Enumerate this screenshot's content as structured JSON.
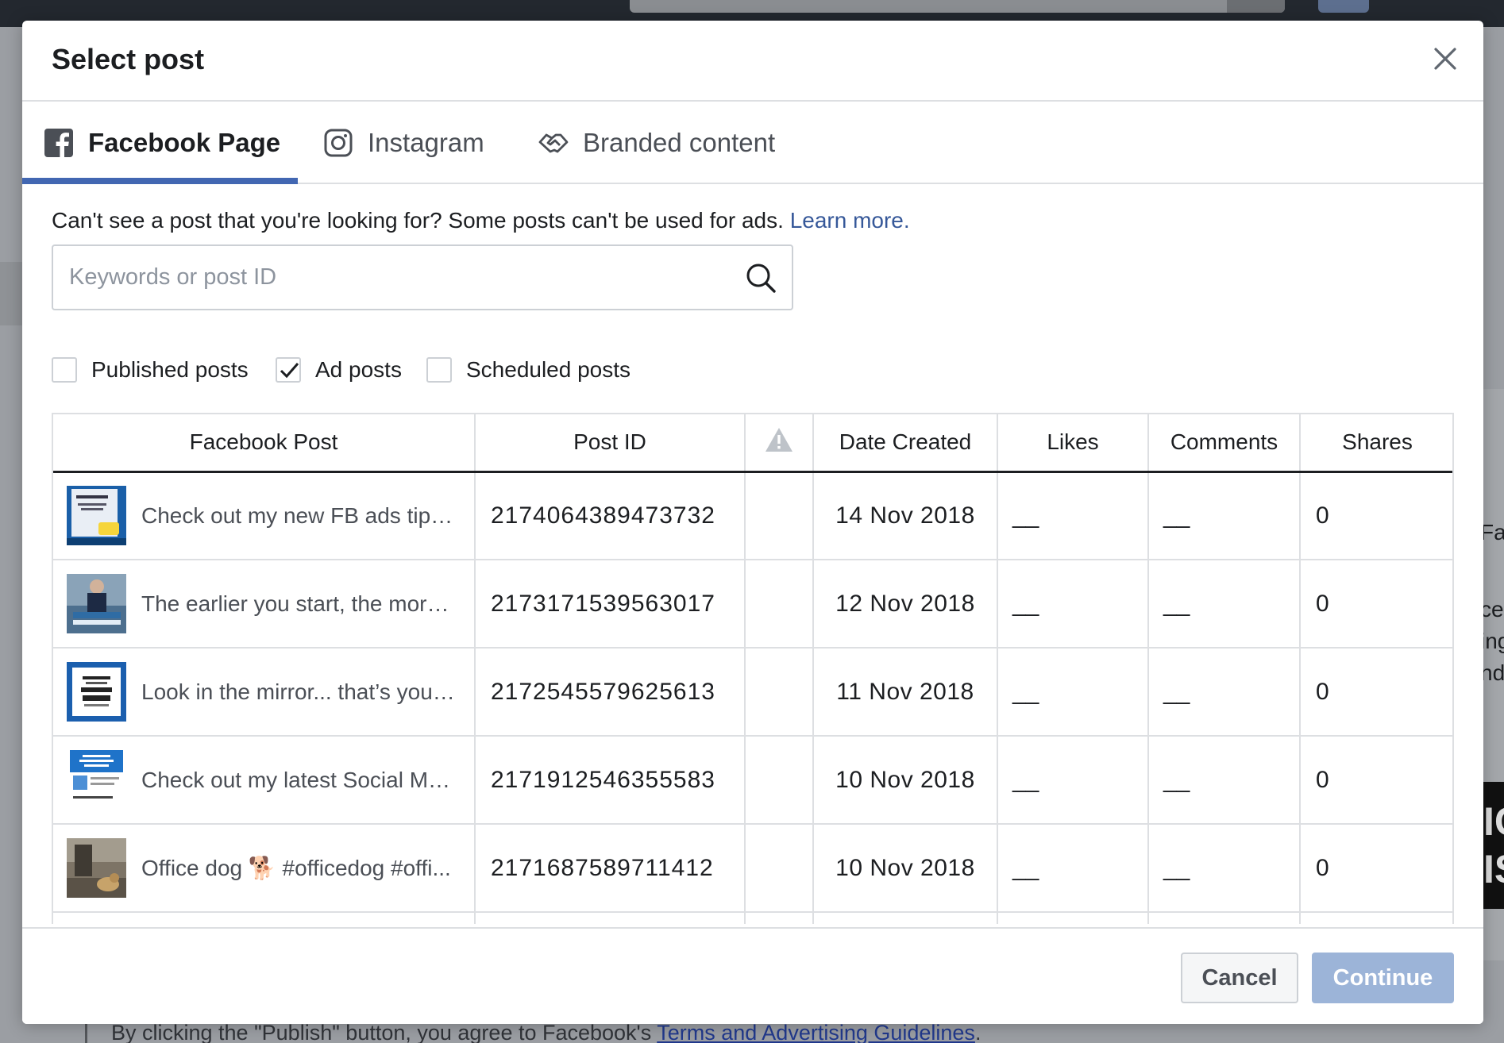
{
  "background": {
    "footer_text": "By clicking the \"Publish\" button, you agree to Facebook's ",
    "footer_link": "Terms and Advertising Guidelines",
    "footer_end": ".",
    "right_fragments": [
      "Fac",
      "ce",
      "ing",
      "nd"
    ],
    "right_black_lines": [
      "IC",
      "IS"
    ]
  },
  "modal": {
    "title": "Select post",
    "close_icon": "close-icon"
  },
  "tabs": [
    {
      "label": "Facebook Page",
      "icon": "facebook-icon",
      "active": true
    },
    {
      "label": "Instagram",
      "icon": "instagram-icon",
      "active": false
    },
    {
      "label": "Branded content",
      "icon": "handshake-icon",
      "active": false
    }
  ],
  "info": {
    "text": "Can't see a post that you're looking for? Some posts can't be used for ads. ",
    "link": "Learn more."
  },
  "search": {
    "placeholder": "Keywords or post ID",
    "value": "",
    "icon": "search-icon"
  },
  "filters": [
    {
      "label": "Published posts",
      "checked": false
    },
    {
      "label": "Ad posts",
      "checked": true
    },
    {
      "label": "Scheduled posts",
      "checked": false
    }
  ],
  "table": {
    "columns": [
      "Facebook Post",
      "Post ID",
      "",
      "Date Created",
      "Likes",
      "Comments",
      "Shares"
    ],
    "warning_icon": "warning-icon",
    "rows": [
      {
        "post": "Check out my new FB ads tips o...",
        "post_id": "2174064389473732",
        "date": "14 Nov 2018",
        "likes": "__",
        "comments": "__",
        "shares": "0"
      },
      {
        "post": "The earlier you start, the more t...",
        "post_id": "2173171539563017",
        "date": "12 Nov 2018",
        "likes": "__",
        "comments": "__",
        "shares": "0"
      },
      {
        "post": "Look in the mirror... that’s your ...",
        "post_id": "2172545579625613",
        "date": "11 Nov 2018",
        "likes": "__",
        "comments": "__",
        "shares": "0"
      },
      {
        "post": "Check out my latest Social Medi...",
        "post_id": "2171912546355583",
        "date": "10 Nov 2018",
        "likes": "__",
        "comments": "__",
        "shares": "0"
      },
      {
        "post": "Office dog 🐕 #officedog #offi...",
        "post_id": "2171687589711412",
        "date": "10 Nov 2018",
        "likes": "__",
        "comments": "__",
        "shares": "0"
      }
    ]
  },
  "footer": {
    "cancel_label": "Cancel",
    "continue_label": "Continue"
  },
  "colors": {
    "accent": "#4267b2",
    "link": "#365899",
    "continue_disabled": "#9cb4d8"
  }
}
